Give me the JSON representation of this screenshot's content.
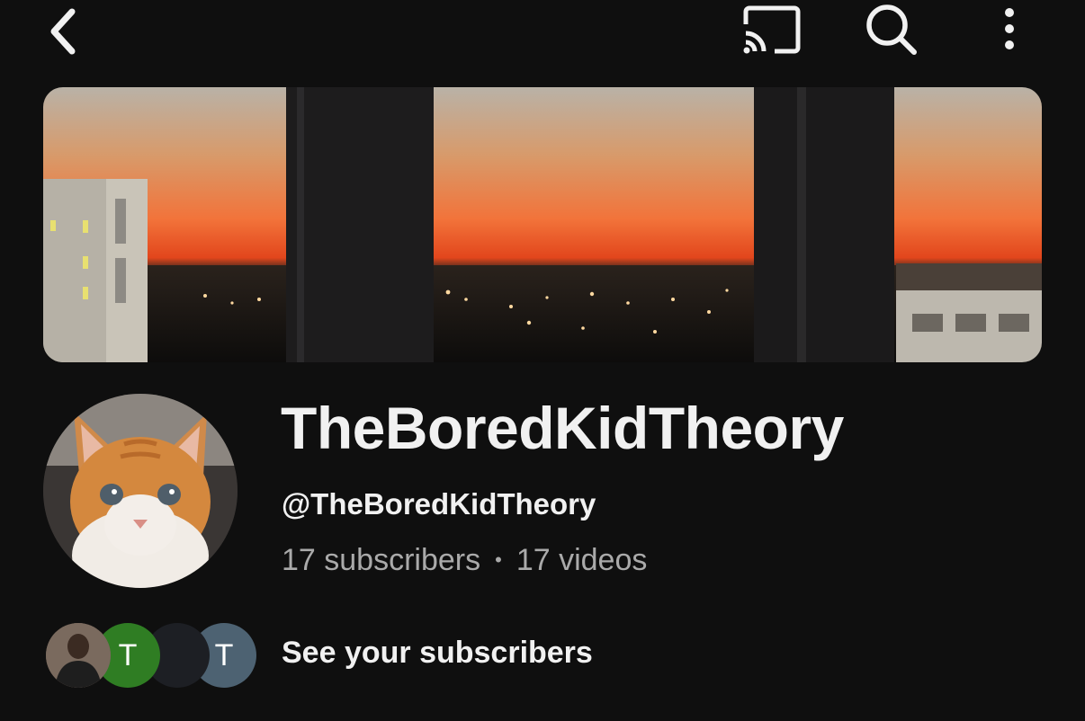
{
  "topbar": {
    "back_icon": "chevron-left-icon",
    "cast_icon": "cast-icon",
    "search_icon": "search-icon",
    "more_icon": "more-vertical-icon"
  },
  "banner": {
    "description_icon": "channel-banner-image"
  },
  "channel": {
    "name": "TheBoredKidTheory",
    "handle": "@TheBoredKidTheory",
    "subscribers": "17 subscribers",
    "separator": "•",
    "videos": "17 videos"
  },
  "subscribers_row": {
    "avatars": [
      {
        "letter": "",
        "color": "#6d5c50"
      },
      {
        "letter": "T",
        "color": "#2f7d23"
      },
      {
        "letter": "",
        "color": "#1d1f24"
      },
      {
        "letter": "T",
        "color": "#4d6272"
      }
    ],
    "link_label": "See your subscribers"
  },
  "colors": {
    "background": "#0f0f0f",
    "text_primary": "#f1f1f1",
    "text_secondary": "#aaaaaa"
  }
}
